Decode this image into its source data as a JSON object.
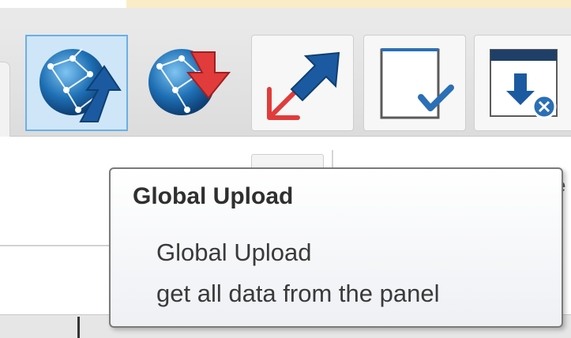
{
  "toolbar": {
    "buttons": [
      {
        "name": "global-upload",
        "icon": "globe-upload-icon",
        "selected": true
      },
      {
        "name": "global-download",
        "icon": "globe-download-icon",
        "selected": false
      },
      {
        "name": "send-receive",
        "icon": "two-way-arrows-icon",
        "selected": false
      },
      {
        "name": "verify",
        "icon": "document-checkmark-icon",
        "selected": false
      },
      {
        "name": "cancel-download",
        "icon": "window-download-cancel-icon",
        "selected": false
      }
    ]
  },
  "tooltip": {
    "title": "Global Upload",
    "line1": "Global Upload",
    "line2": "get all data from the panel"
  },
  "right_edge_fragment": "e",
  "colors": {
    "accent_strip": "#fbecc8",
    "selected_bg": "#cfe6f8",
    "selected_border": "#6ab0e6",
    "globe_blue": "#1e6fb4",
    "arrow_red": "#e23b3b",
    "arrow_dark_blue": "#1b5aa0"
  }
}
